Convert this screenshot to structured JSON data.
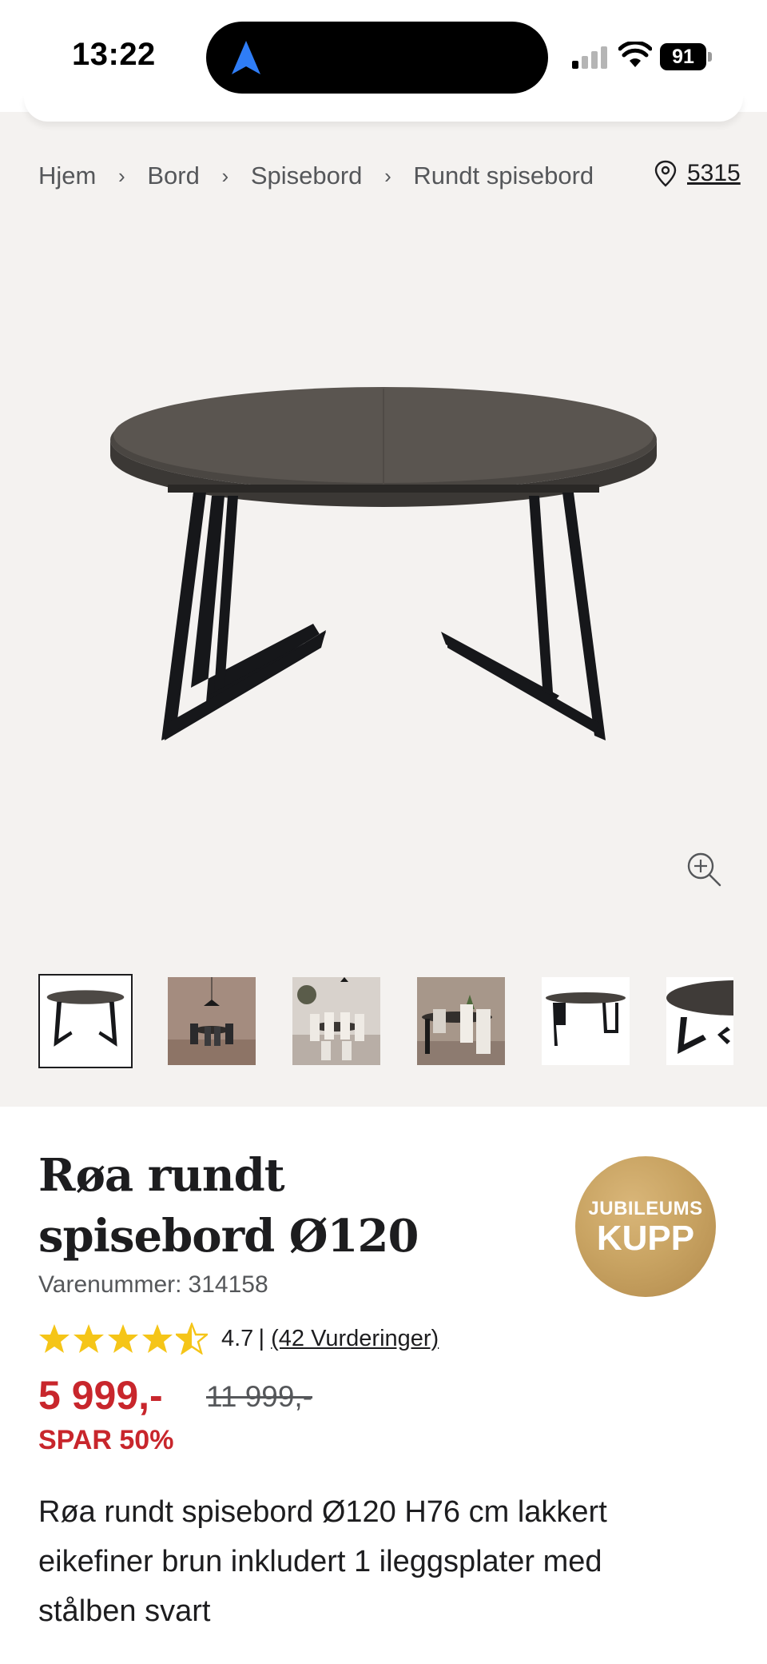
{
  "status_bar": {
    "time": "13:22",
    "battery": "91"
  },
  "breadcrumb": {
    "items": [
      "Hjem",
      "Bord",
      "Spisebord",
      "Rundt spisebord"
    ],
    "separator": "›"
  },
  "location": {
    "code": "5315",
    "icon": "map-pin-icon"
  },
  "gallery": {
    "zoom_icon": "zoom-in-icon",
    "thumbnails": [
      "table-product",
      "dining-room-1",
      "dining-room-2",
      "dining-room-3",
      "table-extended",
      "table-closeup"
    ],
    "active_index": 0
  },
  "product": {
    "title": "Røa rundt spisebord Ø120",
    "sku_label": "Varenummer:",
    "sku": "314158",
    "badge_line1": "JUBILEUMS",
    "badge_line2": "KUPP",
    "rating_value": "4.7",
    "rating_separator": "|",
    "rating_count_text": "(42 Vurderinger)",
    "stars_filled": 4.5,
    "star_color": "#f5c518",
    "price": "5 999,-",
    "old_price": "11 999,-",
    "save_text": "SPAR 50%",
    "price_color": "#c8262c",
    "description": "Røa rundt spisebord Ø120 H76 cm lakkert eikefiner brun inkludert 1 ileggsplater med stålben svart"
  }
}
